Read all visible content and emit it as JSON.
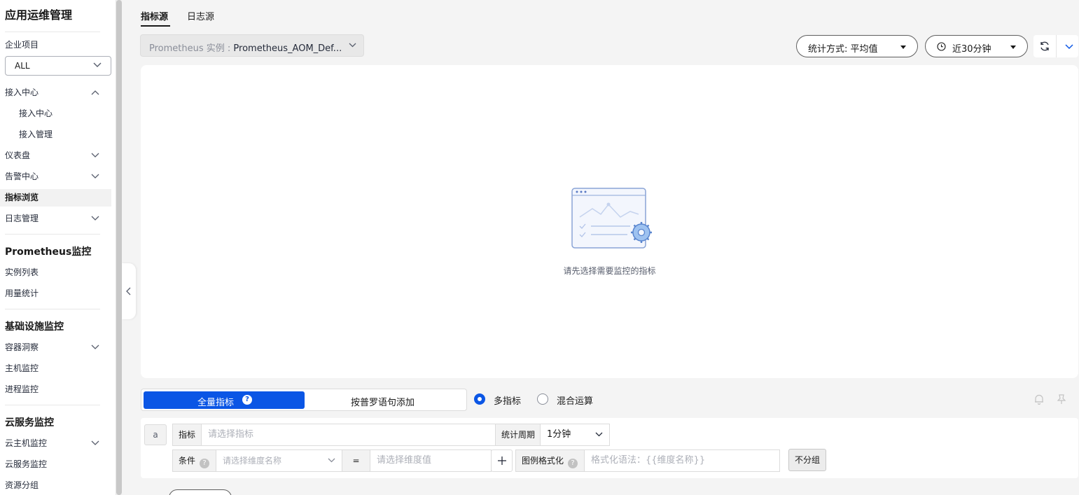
{
  "sidebar": {
    "title": "应用运维管理",
    "enterprise_label": "企业项目",
    "enterprise_value": "ALL",
    "items": [
      {
        "label": "接入中心"
      },
      {
        "label": "接入中心"
      },
      {
        "label": "接入管理"
      },
      {
        "label": "仪表盘"
      },
      {
        "label": "告警中心"
      },
      {
        "label": "指标浏览"
      },
      {
        "label": "日志管理"
      }
    ],
    "sections": {
      "prometheus": {
        "title": "Prometheus监控",
        "items": [
          "实例列表",
          "用量统计"
        ]
      },
      "infra": {
        "title": "基础设施监控",
        "items": [
          "容器洞察",
          "主机监控",
          "进程监控"
        ]
      },
      "cloud": {
        "title": "云服务监控",
        "items": [
          "云主机监控",
          "云服务监控",
          "资源分组"
        ]
      }
    }
  },
  "tabs": [
    {
      "label": "指标源",
      "active": true
    },
    {
      "label": "日志源",
      "active": false
    }
  ],
  "toolbar": {
    "instance_prefix": "Prometheus 实例 : ",
    "instance_value": "Prometheus_AOM_Def...",
    "stat_label": "统计方式: 平均值",
    "time_label": "近30分钟"
  },
  "empty_state": {
    "message": "请先选择需要监控的指标"
  },
  "query": {
    "mode_all": "全量指标",
    "mode_promql": "按普罗语句添加",
    "help_glyph": "?",
    "radio_multi": "多指标",
    "radio_mixed": "混合运算",
    "row_tag": "a",
    "metric_label": "指标",
    "metric_placeholder": "请选择指标",
    "period_label": "统计周期",
    "period_value": "1分钟",
    "condition_label": "条件",
    "dim_name_placeholder": "请选择维度名称",
    "operator": "=",
    "dim_value_placeholder": "请选择维度值",
    "legend_label": "图例格式化",
    "legend_placeholder": "格式化语法：{{维度名称}}",
    "nogroup_label": "不分组"
  },
  "colors": {
    "accent": "#0b56e5",
    "page_bg": "#f4f4f4"
  }
}
